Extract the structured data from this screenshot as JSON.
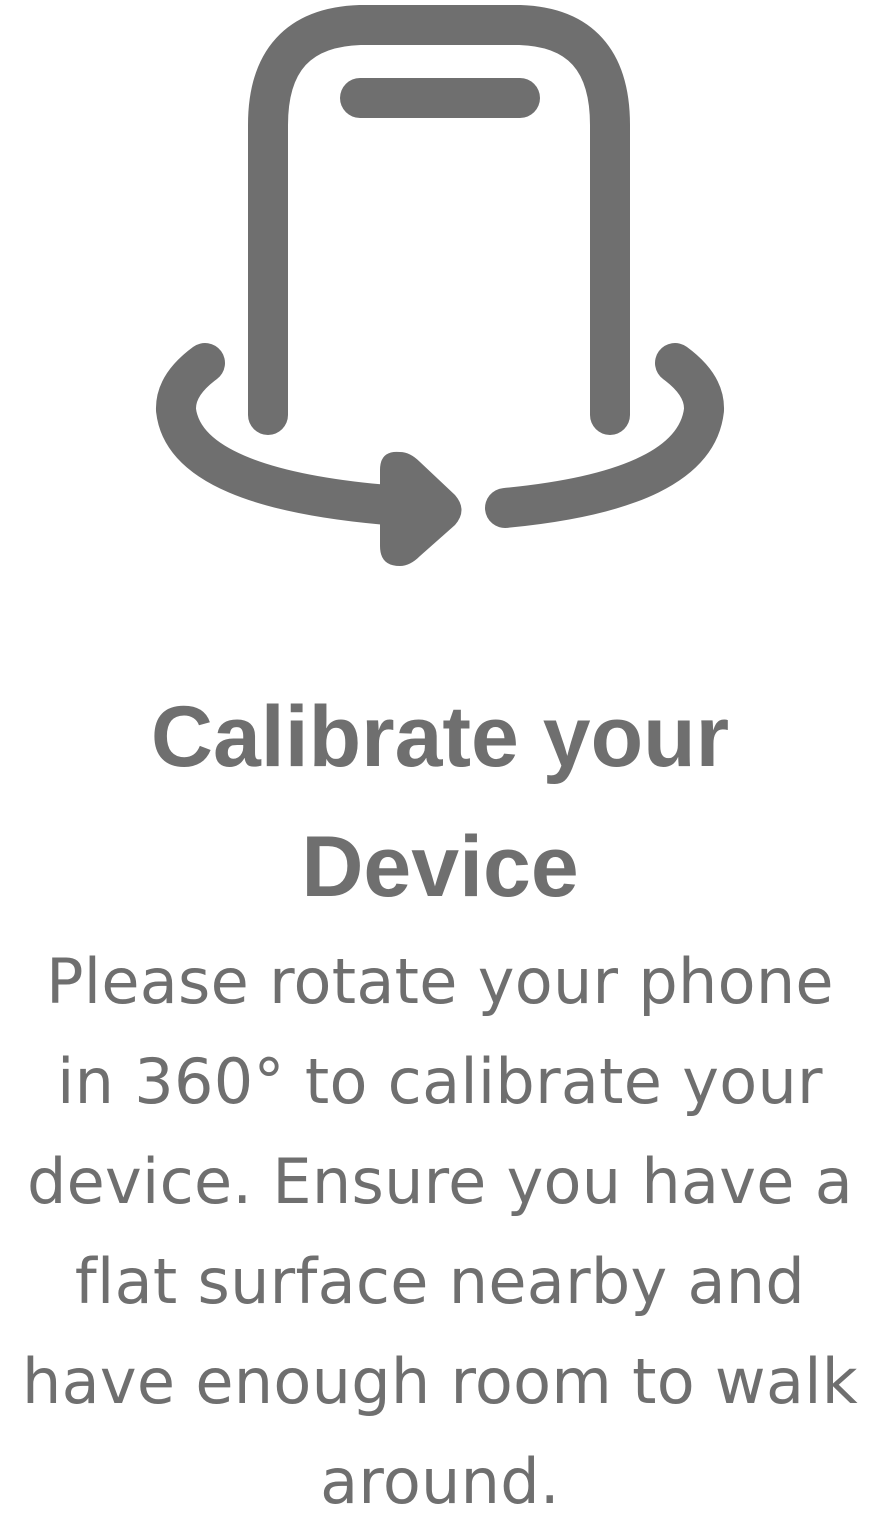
{
  "illustration": {
    "icon": "rotate-phone-icon",
    "color": "#6f6f6f"
  },
  "title": {
    "lines": [
      "Calibrate your",
      "Device"
    ]
  },
  "description": {
    "lines": [
      "Please rotate your phone",
      "in 360° to calibrate your",
      "device. Ensure you have a",
      "flat surface nearby and",
      "have enough room to walk",
      "around."
    ]
  }
}
